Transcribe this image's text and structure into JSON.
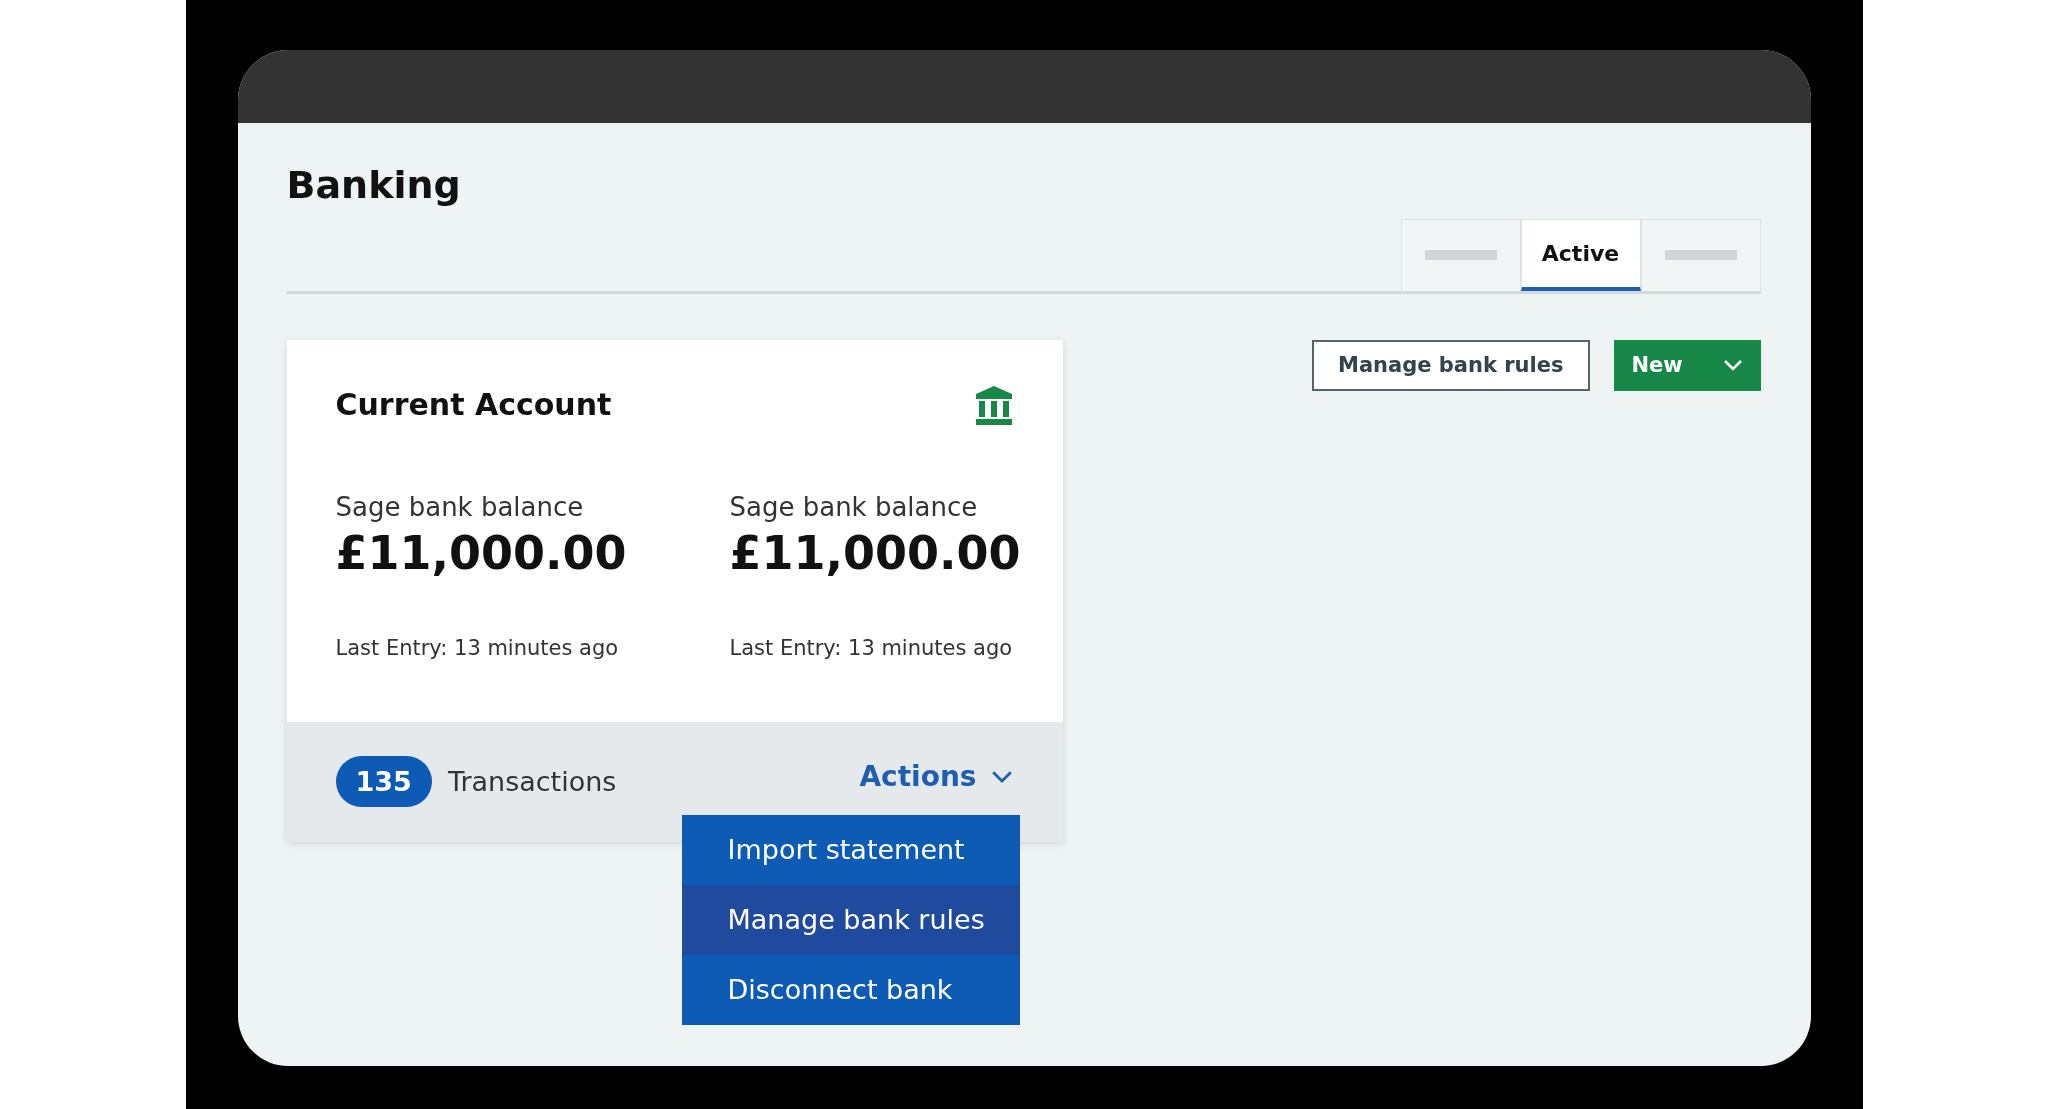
{
  "page": {
    "title": "Banking"
  },
  "tabs": [
    {
      "selected": false
    },
    {
      "label": "Active",
      "selected": true
    },
    {
      "selected": false
    }
  ],
  "toolbar": {
    "secondary_button": "Manage bank rules",
    "primary_button": "New"
  },
  "account_card": {
    "title": "Current Account",
    "balances": [
      {
        "label": "Sage bank balance",
        "amount": "£11,000.00",
        "last_entry": "Last Entry: 13 minutes ago"
      },
      {
        "label": "Sage bank balance",
        "amount": "£11,000.00",
        "last_entry": "Last Entry: 13 minutes ago"
      }
    ],
    "transactions_count": "135",
    "transactions_label": "Transactions",
    "actions_label": "Actions",
    "actions_menu": [
      {
        "label": "Import statement",
        "selected": false
      },
      {
        "label": "Manage bank rules",
        "selected": true
      },
      {
        "label": "Disconnect bank",
        "selected": false
      }
    ]
  }
}
